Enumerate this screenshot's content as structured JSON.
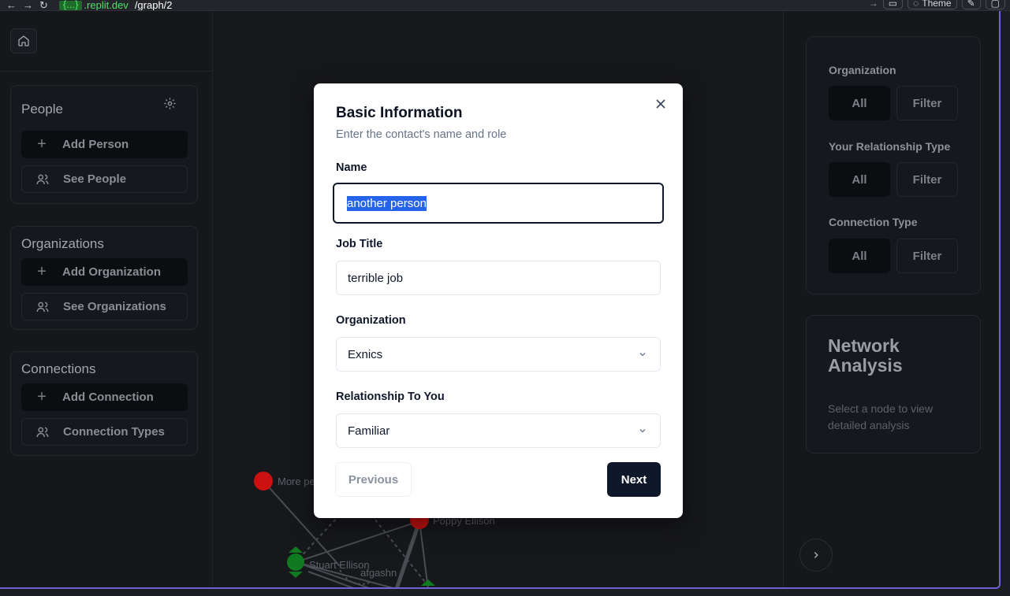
{
  "browser": {
    "url_badge": "{...}",
    "url_host": ".replit.dev",
    "url_path": "/graph/2",
    "theme_label": "Theme"
  },
  "sidebar": {
    "people": {
      "title": "People",
      "add_label": "Add Person",
      "see_label": "See People"
    },
    "organizations": {
      "title": "Organizations",
      "add_label": "Add Organization",
      "see_label": "See Organizations"
    },
    "connections": {
      "title": "Connections",
      "add_label": "Add Connection",
      "types_label": "Connection Types"
    }
  },
  "filters": {
    "organization": {
      "label": "Organization",
      "all": "All",
      "filter": "Filter"
    },
    "relationship": {
      "label": "Your Relationship Type",
      "all": "All",
      "filter": "Filter"
    },
    "connection": {
      "label": "Connection Type",
      "all": "All",
      "filter": "Filter"
    }
  },
  "network": {
    "title": "Network Analysis",
    "description": "Select a node to view detailed analysis"
  },
  "graph": {
    "nodes": [
      {
        "label": "More pe",
        "color": "#cc1111"
      },
      {
        "label": "Poppy Ellison",
        "color": "#cc1111"
      },
      {
        "label": "Stuart Ellison",
        "color": "#0f7a1f"
      },
      {
        "label": "afgashn",
        "color": "#0f7a1f"
      }
    ]
  },
  "modal": {
    "title": "Basic Information",
    "subtitle": "Enter the contact's name and role",
    "name_label": "Name",
    "name_value": "another person",
    "job_label": "Job Title",
    "job_value": "terrible job",
    "org_label": "Organization",
    "org_value": "Exnics",
    "rel_label": "Relationship To You",
    "rel_value": "Familiar",
    "prev_label": "Previous",
    "next_label": "Next"
  }
}
